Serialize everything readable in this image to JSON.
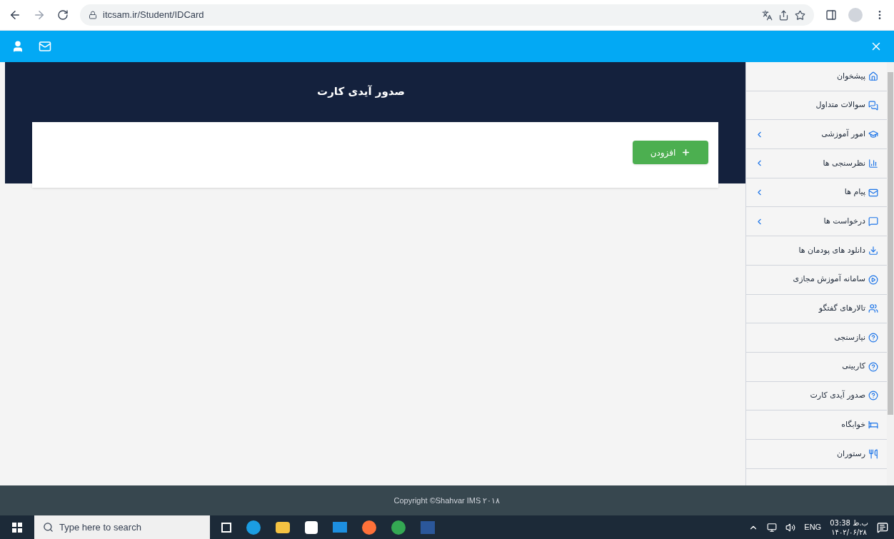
{
  "browser": {
    "url": "itcsam.ir/Student/IDCard"
  },
  "page": {
    "title": "صدور آیدی کارت",
    "add_button": "افزودن"
  },
  "sidebar": {
    "items": [
      {
        "label": "پیشخوان",
        "expandable": false
      },
      {
        "label": "سوالات متداول",
        "expandable": false
      },
      {
        "label": "امور آموزشی",
        "expandable": true
      },
      {
        "label": "نظرسنجی ها",
        "expandable": true
      },
      {
        "label": "پیام ها",
        "expandable": true
      },
      {
        "label": "درخواست ها",
        "expandable": true
      },
      {
        "label": "دانلود های پودمان ها",
        "expandable": false
      },
      {
        "label": "سامانه آموزش مجازی",
        "expandable": false
      },
      {
        "label": "تالارهای گفتگو",
        "expandable": false
      },
      {
        "label": "نیازسنجی",
        "expandable": false
      },
      {
        "label": "کاربینی",
        "expandable": false
      },
      {
        "label": "صدور آیدی کارت",
        "expandable": false
      },
      {
        "label": "خوابگاه",
        "expandable": false
      },
      {
        "label": "رستوران",
        "expandable": false
      }
    ]
  },
  "footer": {
    "text": "Copyright ©Shahvar IMS ۲۰۱۸"
  },
  "taskbar": {
    "search_placeholder": "Type here to search",
    "language": "ENG",
    "time": "03:38 ب.ظ",
    "date": "۱۴۰۲/۰۶/۲۸"
  }
}
